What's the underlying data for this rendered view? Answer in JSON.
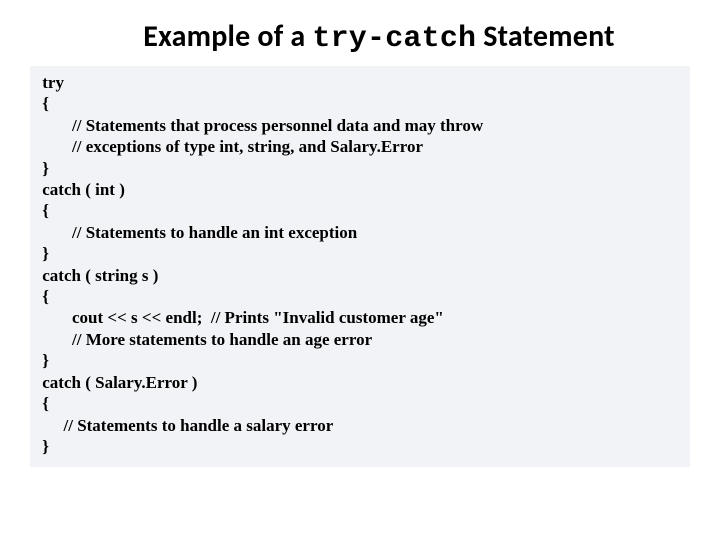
{
  "title": {
    "prefix": "Example of a ",
    "mono": "try-catch",
    "suffix": " Statement"
  },
  "code": " try\n {\n        // Statements that process personnel data and may throw\n        // exceptions of type int, string, and Salary.Error\n }\n catch ( int )\n {\n        // Statements to handle an int exception\n }\n catch ( string s )\n {\n        cout << s << endl;  // Prints \"Invalid customer age\"\n        // More statements to handle an age error\n }\n catch ( Salary.Error )\n {\n      // Statements to handle a salary error\n }"
}
